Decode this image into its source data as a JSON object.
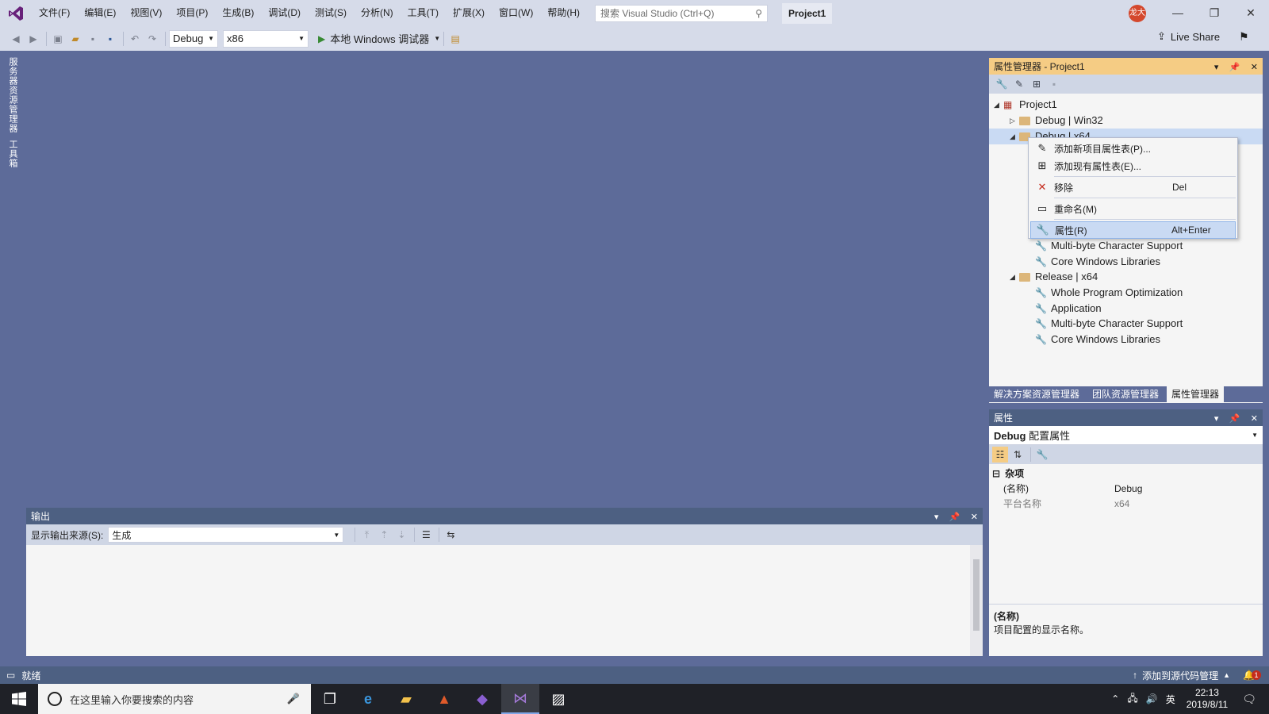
{
  "menubar": {
    "items": [
      "文件(F)",
      "编辑(E)",
      "视图(V)",
      "项目(P)",
      "生成(B)",
      "调试(D)",
      "测试(S)",
      "分析(N)",
      "工具(T)",
      "扩展(X)",
      "窗口(W)",
      "帮助(H)"
    ],
    "search_placeholder": "搜索 Visual Studio (Ctrl+Q)",
    "project_title": "Project1",
    "avatar_text": "龙大"
  },
  "toolbar": {
    "config": "Debug",
    "platform": "x86",
    "run_label": "本地 Windows 调试器",
    "live_share": "Live Share"
  },
  "leftstrip": {
    "tab1": "服务器资源管理器",
    "tab2": "工具箱"
  },
  "property_manager": {
    "title": "属性管理器 - Project1",
    "tree": [
      {
        "label": "Project1",
        "level": 0,
        "kind": "project"
      },
      {
        "label": "Debug | Win32",
        "level": 1,
        "kind": "folder"
      },
      {
        "label": "Debug | x64",
        "level": 1,
        "kind": "folder"
      },
      {
        "label": "Multi-byte Character Support",
        "level": 2,
        "kind": "sheet"
      },
      {
        "label": "Core Windows Libraries",
        "level": 2,
        "kind": "sheet"
      },
      {
        "label": "Release | x64",
        "level": 1,
        "kind": "folder"
      },
      {
        "label": "Whole Program Optimization",
        "level": 2,
        "kind": "sheet"
      },
      {
        "label": "Application",
        "level": 2,
        "kind": "sheet"
      },
      {
        "label": "Multi-byte Character Support",
        "level": 2,
        "kind": "sheet"
      },
      {
        "label": "Core Windows Libraries",
        "level": 2,
        "kind": "sheet"
      }
    ],
    "bottom_tabs": [
      "解决方案资源管理器",
      "团队资源管理器",
      "属性管理器"
    ]
  },
  "context_menu": {
    "items": [
      {
        "label": "添加新项目属性表(P)...",
        "shortcut": ""
      },
      {
        "label": "添加现有属性表(E)...",
        "shortcut": ""
      },
      {
        "label": "移除",
        "shortcut": "Del"
      },
      {
        "label": "重命名(M)",
        "shortcut": ""
      },
      {
        "label": "属性(R)",
        "shortcut": "Alt+Enter"
      }
    ]
  },
  "properties": {
    "title": "属性",
    "object_bold": "Debug",
    "object_rest": "配置属性",
    "category": "杂项",
    "rows": [
      {
        "key": "(名称)",
        "value": "Debug"
      },
      {
        "key": "平台名称",
        "value": "x64"
      }
    ],
    "desc_title": "(名称)",
    "desc_text": "项目配置的显示名称。"
  },
  "output": {
    "title": "输出",
    "source_label": "显示输出来源(S):",
    "source_value": "生成"
  },
  "statusbar": {
    "text": "就绪",
    "source_control": "添加到源代码管理",
    "notification_count": "1"
  },
  "taskbar": {
    "search_placeholder": "在这里输入你要搜索的内容",
    "ime": "英",
    "time": "22:13",
    "date": "2019/8/11"
  }
}
